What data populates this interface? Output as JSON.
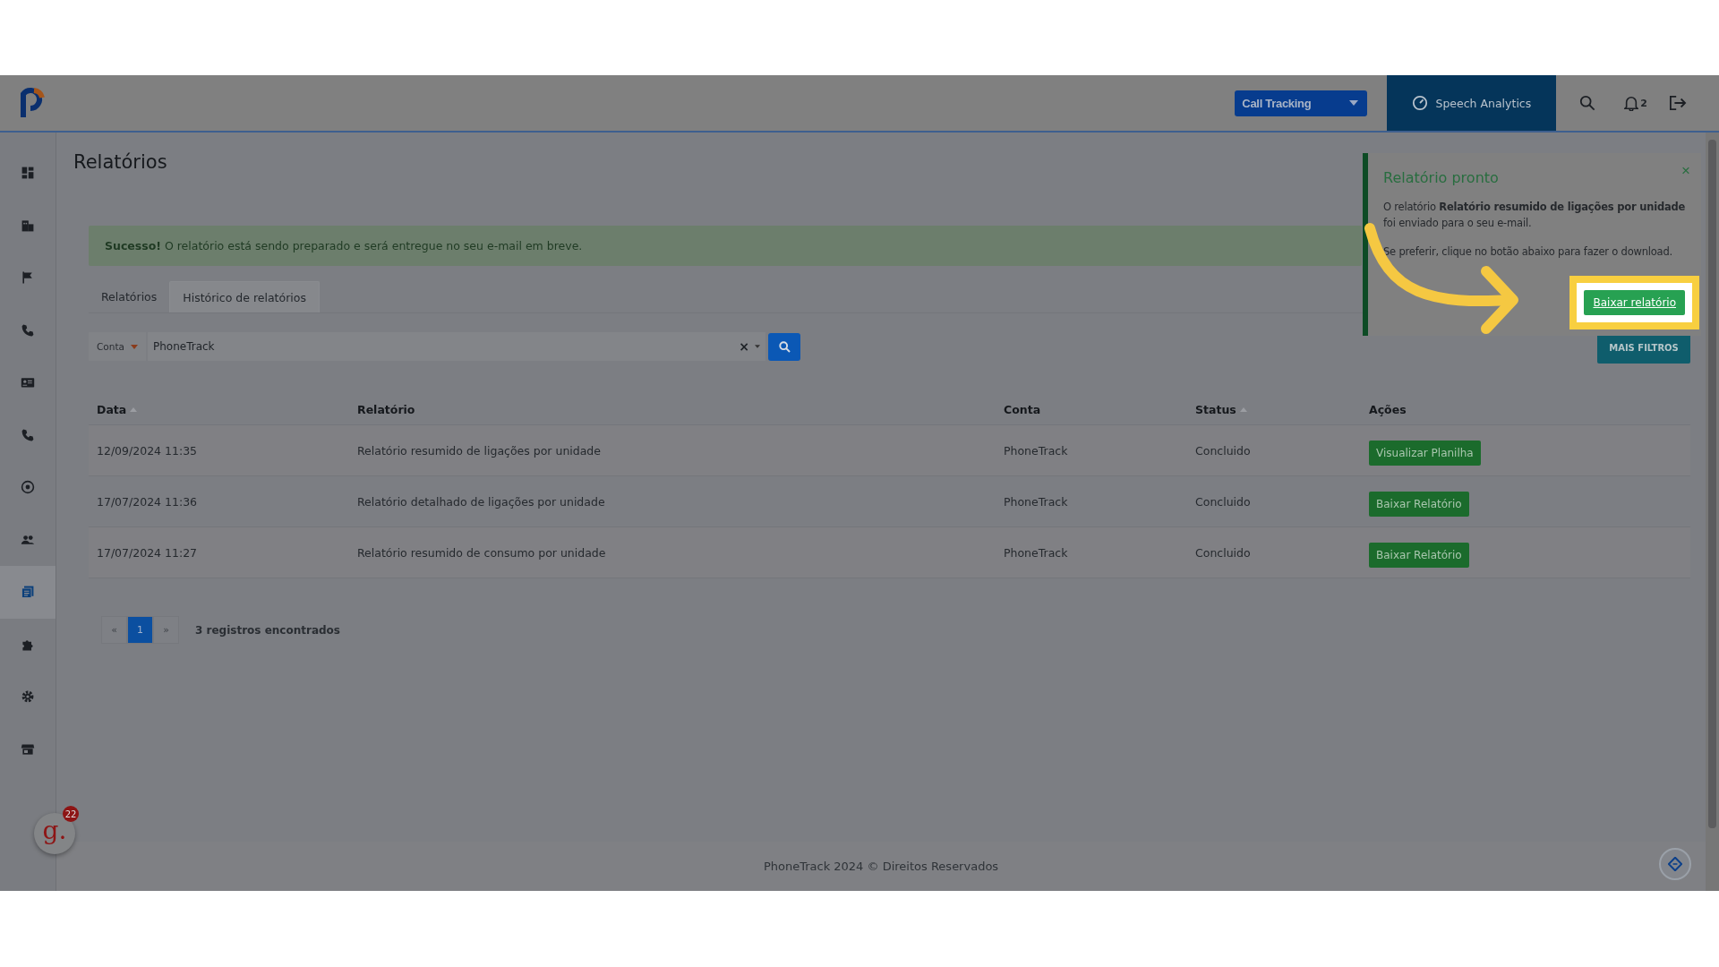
{
  "topbar": {
    "product_select": {
      "value": "Call Tracking"
    },
    "module_tab": {
      "label": "Speech Analytics",
      "selected": true
    },
    "notifications": {
      "count": "2"
    }
  },
  "sidebar": {
    "items": [
      {
        "kind": "dashboard",
        "selected": false
      },
      {
        "kind": "building",
        "selected": false
      },
      {
        "kind": "flag",
        "selected": false
      },
      {
        "kind": "phone",
        "selected": false
      },
      {
        "kind": "card",
        "selected": false
      },
      {
        "kind": "phone",
        "selected": false
      },
      {
        "kind": "gauge",
        "selected": false
      },
      {
        "kind": "users",
        "selected": false
      },
      {
        "kind": "report",
        "selected": true
      },
      {
        "kind": "puzzle",
        "selected": false
      },
      {
        "kind": "gear",
        "selected": false
      },
      {
        "kind": "store",
        "selected": false
      }
    ]
  },
  "page": {
    "title": "Relatórios"
  },
  "alert": {
    "text": "**Sucesso!** O relatório está sendo preparado e será entregue no seu e-mail em breve."
  },
  "tabs": [
    {
      "label": "Relatórios",
      "selected": false
    },
    {
      "label": "Histórico de relatórios",
      "selected": true
    }
  ],
  "filter": {
    "field": "Conta",
    "value": "PhoneTrack",
    "clear": "×",
    "more_button": "MAIS FILTROS"
  },
  "table": {
    "columns": [
      {
        "label": "Data",
        "sortable": true
      },
      {
        "label": "Relatório",
        "sortable": false
      },
      {
        "label": "Conta",
        "sortable": false
      },
      {
        "label": "Status",
        "sortable": true
      },
      {
        "label": "Ações",
        "sortable": false
      }
    ],
    "rows": [
      {
        "date": "12/09/2024 11:35",
        "report": "Relatório resumido de ligações por unidade",
        "account": "PhoneTrack",
        "status": "Concluido",
        "action": "Visualizar Planilha"
      },
      {
        "date": "17/07/2024 11:36",
        "report": "Relatório detalhado de ligações por unidade",
        "account": "PhoneTrack",
        "status": "Concluido",
        "action": "Baixar Relatório"
      },
      {
        "date": "17/07/2024 11:27",
        "report": "Relatório resumido de consumo por unidade",
        "account": "PhoneTrack",
        "status": "Concluido",
        "action": "Baixar Relatório"
      }
    ]
  },
  "pagination": {
    "prev": "«",
    "pages": [
      {
        "label": "1",
        "selected": true
      }
    ],
    "next": "»",
    "summary": "3 registros encontrados"
  },
  "footer": {
    "text": "PhoneTrack 2024 © Direitos Reservados"
  },
  "floating_badge": {
    "label": "g.",
    "count": "22"
  },
  "notification": {
    "title": "Relatório pronto",
    "close": "×",
    "message": "O relatório **Relatório resumido de ligações por unidade** foi enviado para o seu e-mail.",
    "hint": "Se preferir, clique no botão abaixo para fazer o download.",
    "button": "Baixar relatório"
  },
  "annotation": {
    "kind": "arrow",
    "highlight": true
  }
}
